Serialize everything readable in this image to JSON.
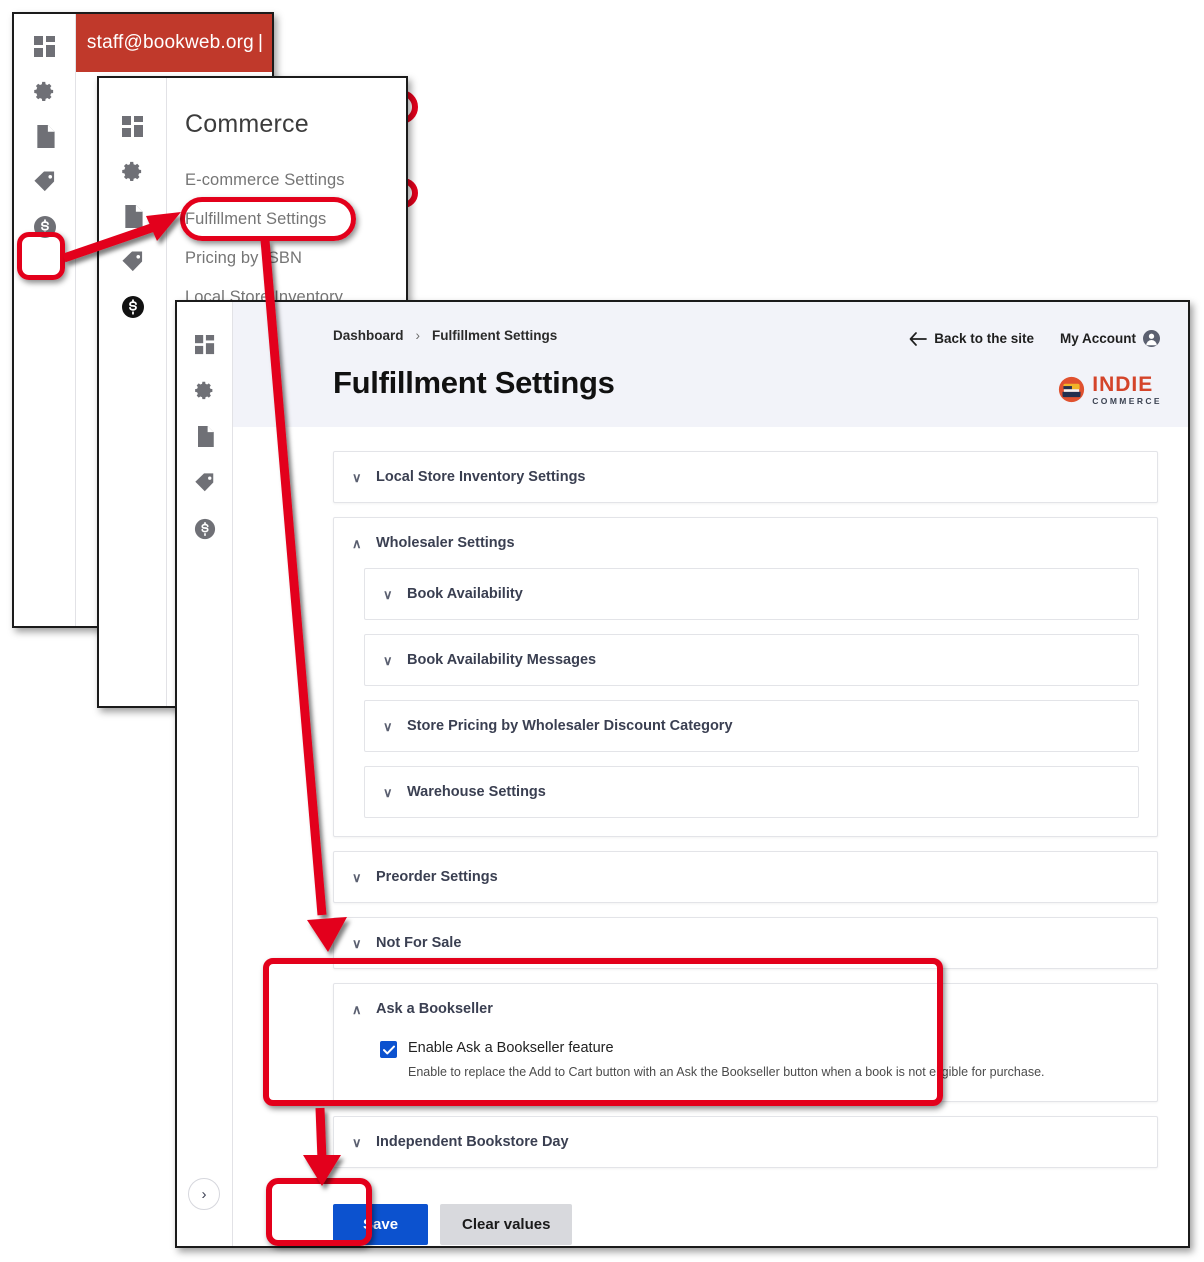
{
  "window1": {
    "user_email": "staff@bookweb.org",
    "rail_icons": [
      "dashboard-grid-icon",
      "gear-icon",
      "page-icon",
      "tag-icon",
      "dollar-circle-icon"
    ]
  },
  "window2": {
    "menu_title": "Commerce",
    "menu_items": [
      "E-commerce Settings",
      "Fulfillment Settings",
      "Pricing by ISBN",
      "Local Store Inventory"
    ],
    "rail_icons": [
      "dashboard-grid-icon",
      "gear-icon",
      "page-icon",
      "tag-icon",
      "dollar-circle-icon"
    ]
  },
  "window3": {
    "breadcrumb": {
      "root": "Dashboard",
      "separator": "›",
      "current": "Fulfillment Settings"
    },
    "top_actions": {
      "back": "Back to the site",
      "account": "My Account"
    },
    "page_title": "Fulfillment Settings",
    "brand": {
      "main": "INDIE",
      "sub": "COMMERCE"
    },
    "rail_icons": [
      "dashboard-grid-icon",
      "gear-icon",
      "page-icon",
      "tag-icon",
      "dollar-circle-icon"
    ],
    "expand_label": "›",
    "sections": [
      {
        "label": "Local Store Inventory Settings",
        "state": "collapsed"
      },
      {
        "label": "Wholesaler Settings",
        "state": "expanded"
      },
      {
        "label": "Book Availability",
        "state": "collapsed"
      },
      {
        "label": "Book Availability Messages",
        "state": "collapsed"
      },
      {
        "label": "Store Pricing by Wholesaler Discount Category",
        "state": "collapsed"
      },
      {
        "label": "Warehouse Settings",
        "state": "collapsed"
      },
      {
        "label": "Preorder Settings",
        "state": "collapsed"
      },
      {
        "label": "Not For Sale",
        "state": "collapsed"
      },
      {
        "label": "Ask a Bookseller",
        "state": "expanded"
      },
      {
        "label": "Independent Bookstore Day",
        "state": "collapsed"
      }
    ],
    "ask_a_bookseller": {
      "checkbox_label": "Enable Ask a Bookseller feature",
      "checkbox_checked": true,
      "description": "Enable to replace the Add to Cart button with an Ask the Bookseller button when a book is not eligible for purchase."
    },
    "buttons": {
      "save": "Save",
      "clear": "Clear values"
    }
  },
  "colors": {
    "user_bar_red": "#c0392b",
    "annotation_red": "#e3001b",
    "primary_blue": "#0c52cf",
    "brand_red": "#d4442a",
    "page_head_bg": "#f2f3f9"
  },
  "chevrons": {
    "collapsed": "∨",
    "expanded": "∧"
  }
}
